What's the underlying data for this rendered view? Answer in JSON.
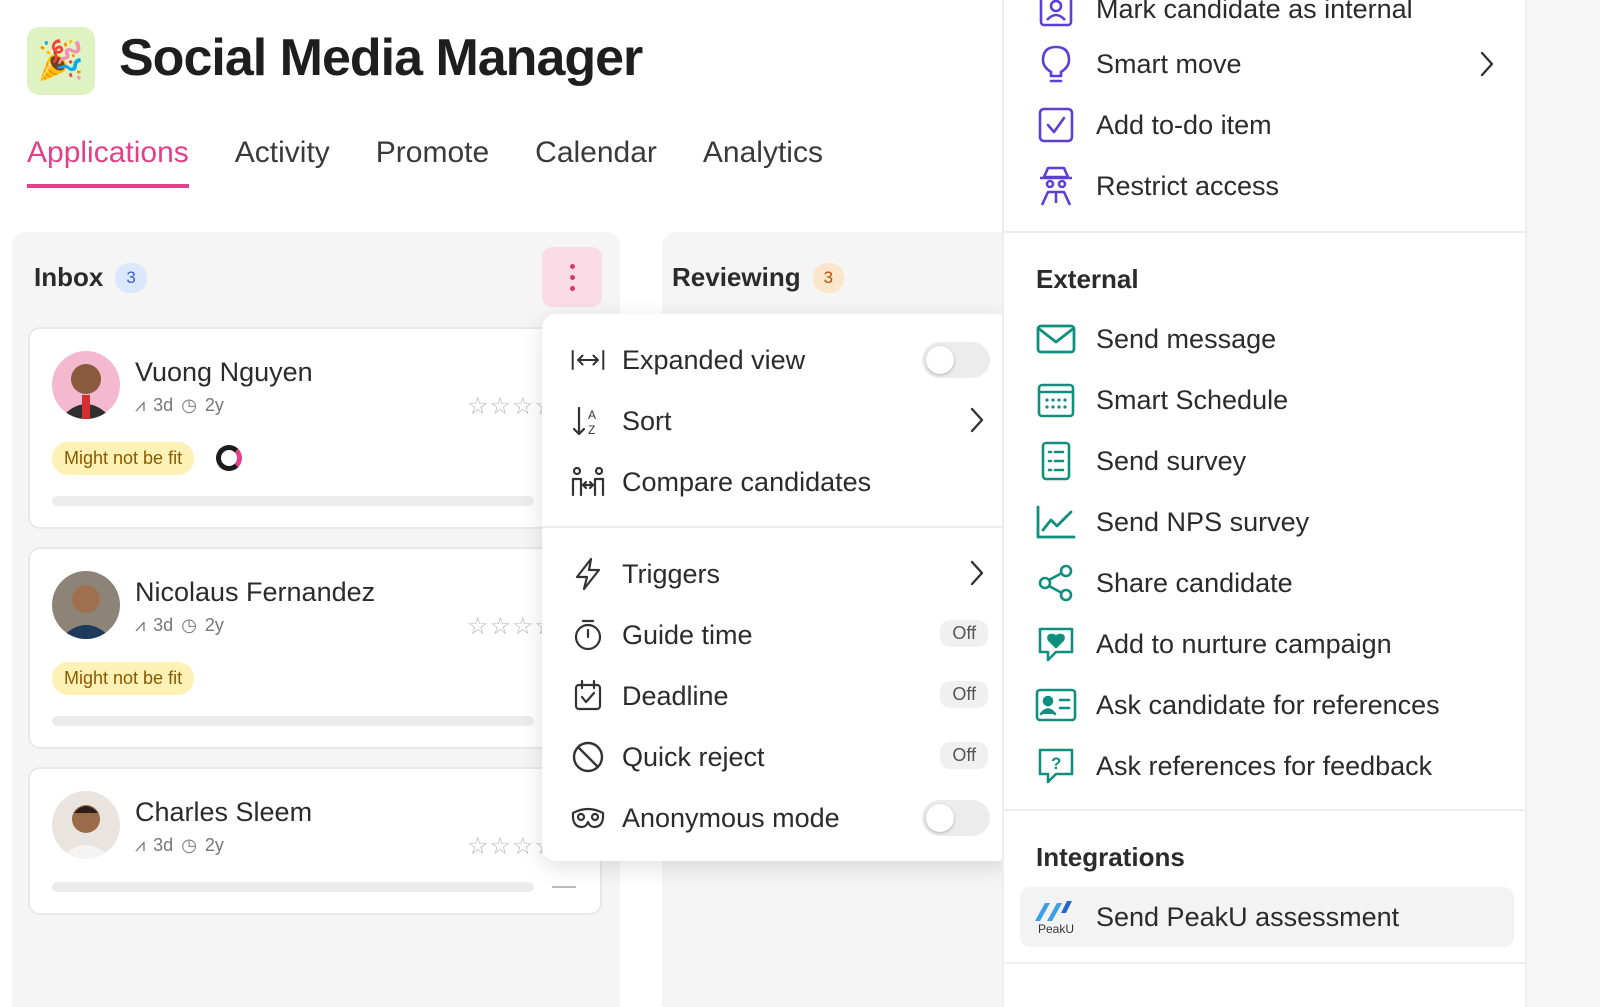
{
  "header": {
    "app_icon_emoji": "🎉",
    "title": "Social Media Manager"
  },
  "tabs": [
    {
      "label": "Applications",
      "active": true
    },
    {
      "label": "Activity"
    },
    {
      "label": "Promote"
    },
    {
      "label": "Calendar"
    },
    {
      "label": "Analytics"
    }
  ],
  "columns": {
    "inbox": {
      "title": "Inbox",
      "count": "3"
    },
    "reviewing": {
      "title": "Reviewing",
      "count": "3"
    }
  },
  "candidates": [
    {
      "name": "Vuong Nguyen",
      "activity": "3d",
      "age": "2y",
      "stars": "☆☆☆☆",
      "tag": "Might not be fit"
    },
    {
      "name": "Nicolaus Fernandez",
      "activity": "3d",
      "age": "2y",
      "stars": "☆☆☆☆",
      "tag": "Might not be fit"
    },
    {
      "name": "Charles Sleem",
      "activity": "3d",
      "age": "2y",
      "stars": "☆☆☆☆",
      "tag": ""
    }
  ],
  "column_menu": {
    "items": [
      {
        "label": "Expanded view",
        "icon": "expand-horizontal-icon",
        "control": "toggle-off"
      },
      {
        "label": "Sort",
        "icon": "sort-icon",
        "control": "chevron"
      },
      {
        "label": "Compare candidates",
        "icon": "compare-icon"
      },
      {
        "label": "Triggers",
        "icon": "lightning-icon",
        "control": "chevron"
      },
      {
        "label": "Guide time",
        "icon": "stopwatch-icon",
        "control": "Off"
      },
      {
        "label": "Deadline",
        "icon": "calendar-check-icon",
        "control": "Off"
      },
      {
        "label": "Quick reject",
        "icon": "prohibited-icon",
        "control": "Off"
      },
      {
        "label": "Anonymous mode",
        "icon": "mask-icon",
        "control": "toggle-off"
      }
    ]
  },
  "candidate_menu": {
    "internal_items": [
      {
        "label": "Mark candidate as internal",
        "icon": "id-badge-icon"
      },
      {
        "label": "Smart move",
        "icon": "lightbulb-icon",
        "control": "chevron"
      },
      {
        "label": "Add to-do item",
        "icon": "checkbox-icon"
      },
      {
        "label": "Restrict access",
        "icon": "spy-icon"
      }
    ],
    "external_title": "External",
    "external_items": [
      {
        "label": "Send message",
        "icon": "envelope-icon"
      },
      {
        "label": "Smart Schedule",
        "icon": "calendar-grid-icon"
      },
      {
        "label": "Send survey",
        "icon": "clipboard-list-icon"
      },
      {
        "label": "Send NPS survey",
        "icon": "line-chart-icon"
      },
      {
        "label": "Share candidate",
        "icon": "share-icon"
      },
      {
        "label": "Add to nurture campaign",
        "icon": "heart-message-icon"
      },
      {
        "label": "Ask candidate for references",
        "icon": "contact-card-icon"
      },
      {
        "label": "Ask references for feedback",
        "icon": "question-message-icon"
      }
    ],
    "integrations_title": "Integrations",
    "integration_items": [
      {
        "label": "Send PeakU assessment",
        "icon": "peaku-logo-icon",
        "logo_text": "PeakU"
      }
    ]
  },
  "colors": {
    "accent_pink": "#e0418a",
    "purple_icon": "#5b3fd6",
    "teal_icon": "#0f8f7f"
  }
}
